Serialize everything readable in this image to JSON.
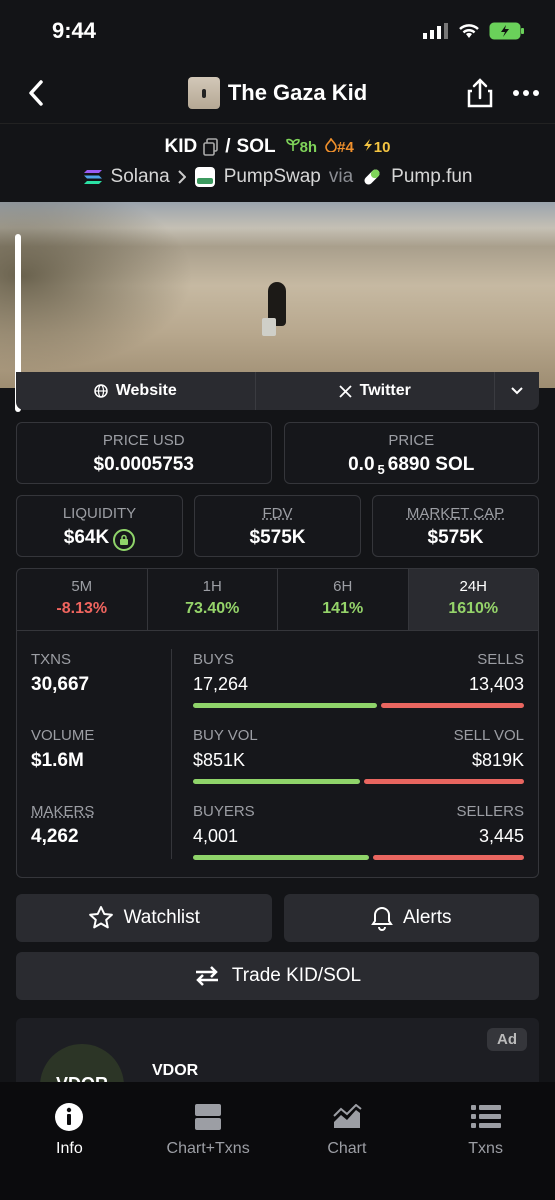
{
  "status": {
    "time": "9:44"
  },
  "header": {
    "title": "The Gaza Kid"
  },
  "pair": {
    "base": "KID",
    "sep": "/",
    "quote": "SOL",
    "age": "8h",
    "rank": "#4",
    "boosts": "10"
  },
  "route": {
    "chain": "Solana",
    "dex": "PumpSwap",
    "via": "via",
    "launchpad": "Pump.fun"
  },
  "links": {
    "website": "Website",
    "twitter": "Twitter"
  },
  "price": {
    "usd_label": "PRICE USD",
    "usd": "$0.0005753",
    "native_label": "PRICE",
    "native_prefix": "0.0",
    "native_zeros": "5",
    "native_rest": "6890 SOL"
  },
  "metrics": [
    {
      "label": "LIQUIDITY",
      "value": "$64K"
    },
    {
      "label": "FDV",
      "value": "$575K"
    },
    {
      "label": "MARKET CAP",
      "value": "$575K"
    }
  ],
  "tabs": [
    {
      "label": "5M",
      "value": "-8.13%"
    },
    {
      "label": "1H",
      "value": "73.40%"
    },
    {
      "label": "6H",
      "value": "141%"
    },
    {
      "label": "24H",
      "value": "1610%"
    }
  ],
  "stats": {
    "txns": {
      "label": "TXNS",
      "value": "30,667",
      "buys_label": "BUYS",
      "buys": "17,264",
      "sells_label": "SELLS",
      "sells": "13,403",
      "buy_fraction": 0.563
    },
    "volume": {
      "label": "VOLUME",
      "value": "$1.6M",
      "buys_label": "BUY VOL",
      "buys": "$851K",
      "sells_label": "SELL VOL",
      "sells": "$819K",
      "buy_fraction": 0.51
    },
    "makers": {
      "label": "MAKERS",
      "value": "4,262",
      "buys_label": "BUYERS",
      "buys": "4,001",
      "sells_label": "SELLERS",
      "sells": "3,445",
      "buy_fraction": 0.537
    }
  },
  "actions": {
    "watchlist": "Watchlist",
    "alerts": "Alerts",
    "trade": "Trade KID/SOL"
  },
  "ad": {
    "badge": "Ad",
    "name": "VDOR",
    "logo_text": "VDOR"
  },
  "tabbar": [
    {
      "label": "Info",
      "icon": "info-icon"
    },
    {
      "label": "Chart+Txns",
      "icon": "layout-icon"
    },
    {
      "label": "Chart",
      "icon": "chart-icon"
    },
    {
      "label": "Txns",
      "icon": "list-icon"
    }
  ]
}
